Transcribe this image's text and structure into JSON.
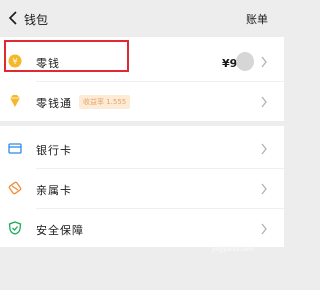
{
  "header": {
    "title": "钱包",
    "bills_label": "账单"
  },
  "wallet_items": {
    "change": {
      "label": "零钱",
      "amount_prefix": "¥",
      "amount_visible": "¥9"
    },
    "change_plus": {
      "label": "零钱通",
      "tag": "收益率 1.555"
    }
  },
  "services": [
    {
      "label": "银行卡",
      "icon": "bank-card-icon"
    },
    {
      "label": "亲属卡",
      "icon": "family-card-icon"
    },
    {
      "label": "安全保障",
      "icon": "shield-check-icon"
    }
  ],
  "watermark": {
    "brand": "经验啦",
    "url": "jingyanla.com"
  },
  "colors": {
    "background": "#ededed",
    "card": "#ffffff",
    "highlight": "#e02a32",
    "gold": "#f5b829",
    "bank_blue": "#2f8ae5",
    "family_orange": "#f08c38",
    "shield_green": "#1aad5a",
    "tag_bg": "#fdebd6",
    "tag_text": "#e5a56b"
  }
}
